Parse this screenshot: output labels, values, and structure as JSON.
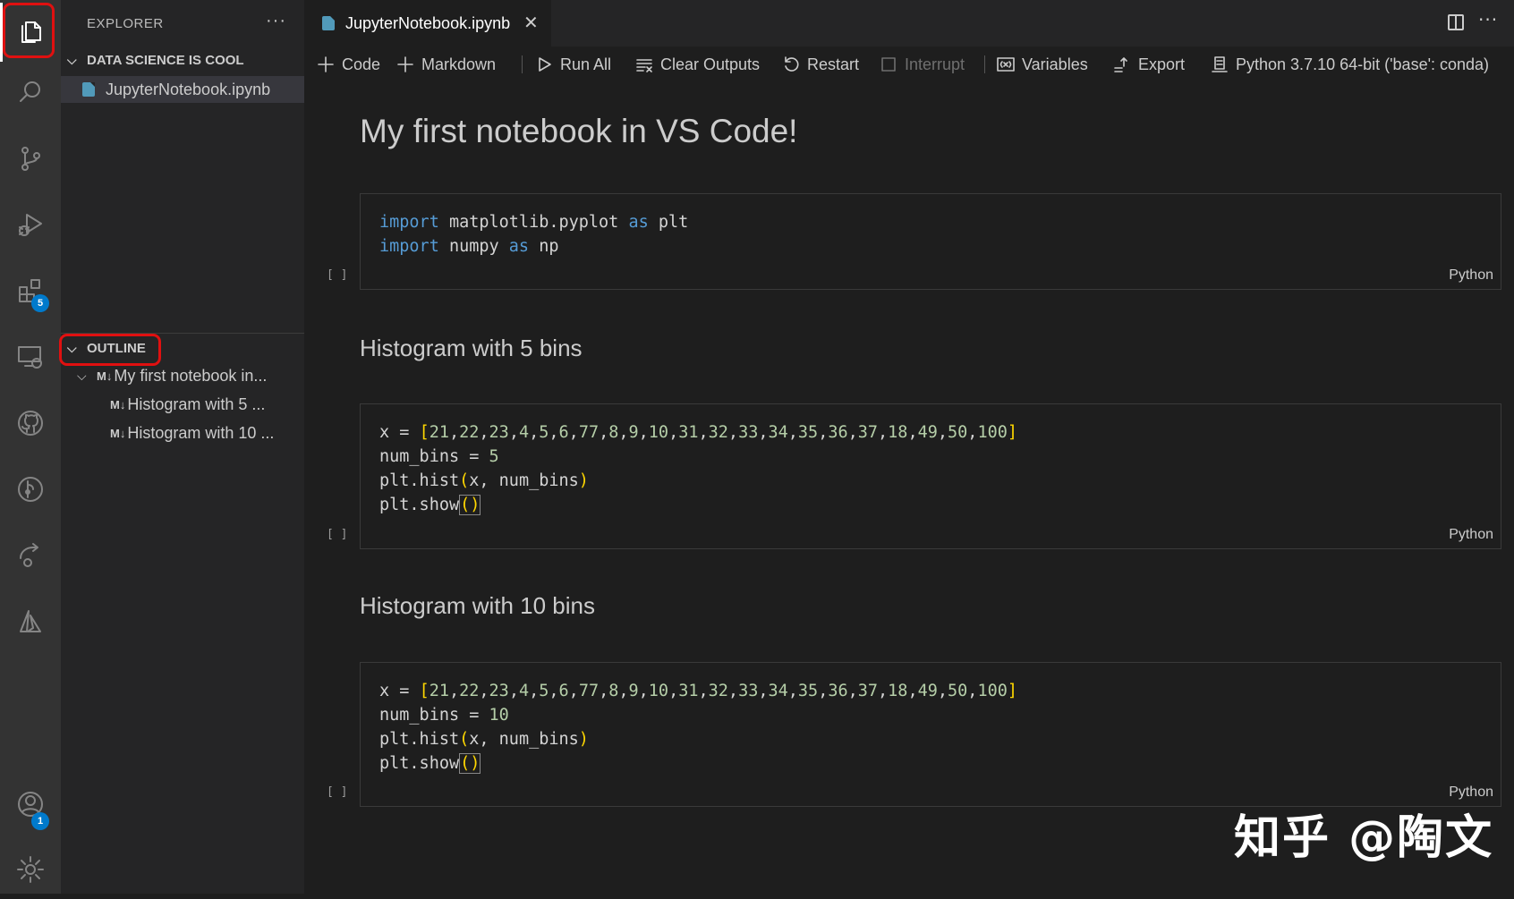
{
  "activity_bar": {
    "items": [
      {
        "name": "explorer",
        "icon": "files-icon"
      },
      {
        "name": "search",
        "icon": "search-icon"
      },
      {
        "name": "source-control",
        "icon": "source-control-icon"
      },
      {
        "name": "run-debug",
        "icon": "run-debug-icon"
      },
      {
        "name": "extensions",
        "icon": "extensions-icon",
        "badge": "5"
      },
      {
        "name": "remote-explorer",
        "icon": "remote-explorer-icon"
      },
      {
        "name": "github",
        "icon": "github-icon"
      },
      {
        "name": "gitlens",
        "icon": "gitlens-icon"
      },
      {
        "name": "live-share",
        "icon": "live-share-icon"
      },
      {
        "name": "azure",
        "icon": "azure-icon"
      }
    ],
    "bottom_items": [
      {
        "name": "accounts",
        "icon": "account-icon",
        "badge": "1"
      },
      {
        "name": "manage",
        "icon": "gear-icon"
      }
    ],
    "badge_color": "#007acc"
  },
  "sidebar": {
    "title": "EXPLORER",
    "more_label": "···",
    "folder_section": {
      "title": "DATA SCIENCE IS COOL",
      "files": [
        "JupyterNotebook.ipynb"
      ]
    },
    "outline_section": {
      "title": "OUTLINE",
      "md_badge": "M↓",
      "items": [
        {
          "label": "My first notebook in..."
        },
        {
          "label": "Histogram with 5 ..."
        },
        {
          "label": "Histogram with 10 ..."
        }
      ]
    }
  },
  "editor": {
    "tab": {
      "label": "JupyterNotebook.ipynb",
      "close": "✕"
    },
    "more_label": "···",
    "toolbar": {
      "code": "Code",
      "markdown": "Markdown",
      "run_all": "Run All",
      "clear_outputs": "Clear Outputs",
      "restart": "Restart",
      "interrupt": "Interrupt",
      "variables": "Variables",
      "export": "Export",
      "kernel": "Python 3.7.10 64-bit ('base': conda)"
    }
  },
  "notebook": {
    "heading1": "My first notebook in VS Code!",
    "cell1": {
      "exec": "[ ]",
      "lang": "Python"
    },
    "heading2": "Histogram with 5 bins",
    "cell2": {
      "exec": "[ ]",
      "lang": "Python"
    },
    "heading3": "Histogram with 10 bins",
    "cell3": {
      "exec": "[ ]",
      "lang": "Python"
    }
  },
  "watermark": "知乎 @陶文",
  "colors": {
    "highlight_box": "#e01010",
    "keyword": "#569cd6",
    "number": "#b5cea8",
    "bracket": "#ffd700"
  }
}
